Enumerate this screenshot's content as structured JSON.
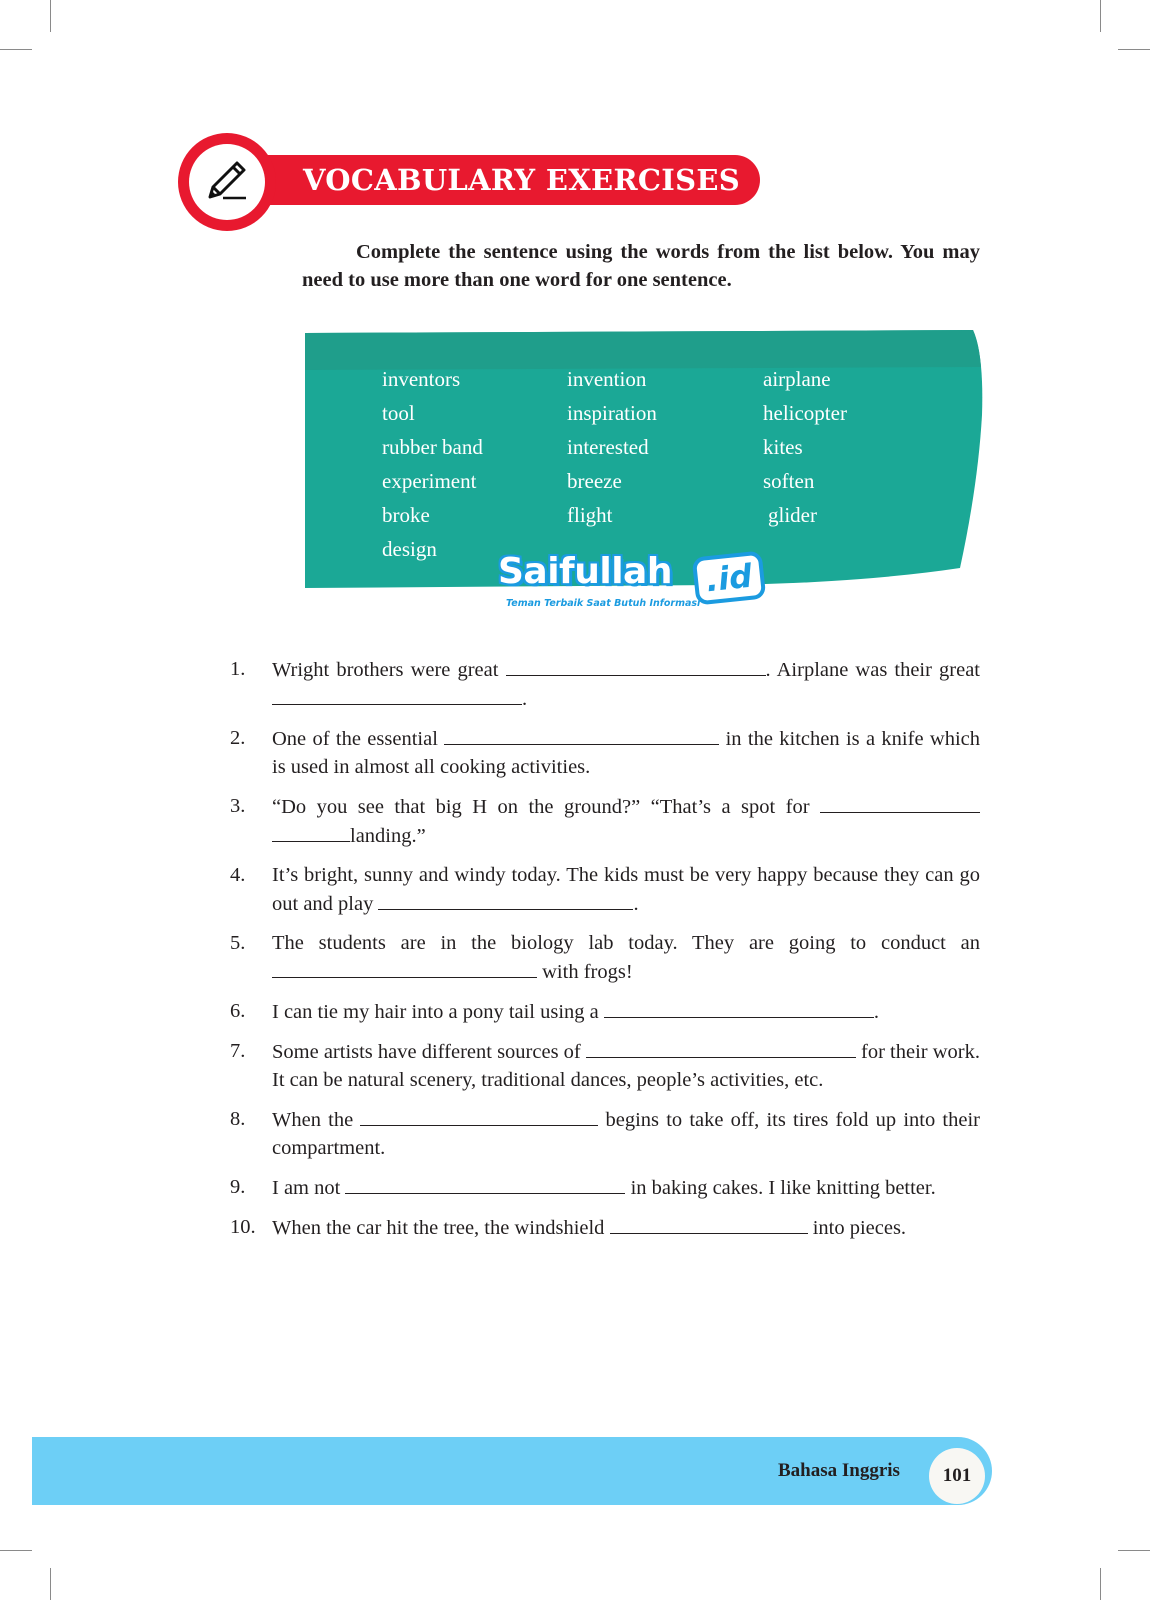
{
  "header": {
    "icon": "pencil-icon",
    "title": "VOCABULARY EXERCISES",
    "colors": {
      "banner": "#e8192f"
    }
  },
  "instructions": "Complete the sentence using the words from the list below. You may need to use more than one word for one sentence.",
  "word_list": {
    "color": "#1ba896",
    "columns": [
      [
        "inventors",
        "tool",
        "rubber band",
        "experiment",
        "broke",
        "design"
      ],
      [
        "invention",
        "inspiration",
        "interested",
        "breeze",
        "flight"
      ],
      [
        "airplane",
        "helicopter",
        "kites",
        "soften",
        "glider"
      ]
    ]
  },
  "watermark": {
    "brand": "Saifullah",
    "suffix": ".id",
    "tagline": "Teman Terbaik Saat Butuh Informasi"
  },
  "exercises": [
    {
      "number": "1.",
      "parts": [
        "Wright brothers were great ",
        {
          "blank": 260
        },
        ". Airplane was their great ",
        {
          "blank": 250
        },
        "."
      ]
    },
    {
      "number": "2.",
      "parts": [
        "One of the essential ",
        {
          "blank": 275
        },
        " in the kitchen is a knife which is used in almost all cooking activities."
      ]
    },
    {
      "number": "3.",
      "parts": [
        "“Do  you see that big H on the ground?” “That’s a spot for ",
        {
          "blank": 160
        },
        " ",
        {
          "blank": 78
        },
        "landing.”"
      ]
    },
    {
      "number": "4.",
      "parts": [
        "It’s bright, sunny and windy today. The kids must be very happy because they can go out and play ",
        {
          "blank": 255
        },
        "."
      ]
    },
    {
      "number": "5.",
      "parts": [
        "The students are in the biology lab today. They are going to conduct an ",
        {
          "blank": 265
        },
        " with frogs!"
      ]
    },
    {
      "number": "6.",
      "parts": [
        "I can tie my hair into a pony tail using a ",
        {
          "blank": 270
        },
        "."
      ]
    },
    {
      "number": "7.",
      "parts": [
        "Some artists have different sources of ",
        {
          "blank": 270
        },
        " for their work. It can be natural scenery, traditional dances, people’s activities, etc."
      ]
    },
    {
      "number": "8.",
      "parts": [
        "When the ",
        {
          "blank": 238
        },
        " begins to take off, its tires fold up into their compartment."
      ]
    },
    {
      "number": "9.",
      "parts": [
        "I am not ",
        {
          "blank": 280
        },
        " in baking cakes. I like knitting better."
      ]
    },
    {
      "number": "10.",
      "parts": [
        "When the car hit the tree, the windshield ",
        {
          "blank": 198
        },
        " into pieces."
      ]
    }
  ],
  "footer": {
    "subject": "Bahasa Inggris",
    "page_number": "101",
    "color": "#6dcff6"
  }
}
